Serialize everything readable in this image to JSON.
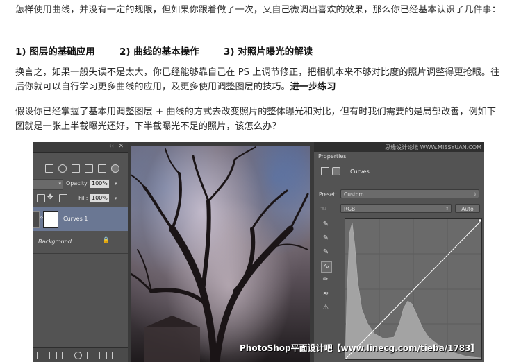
{
  "article": {
    "p1": "怎样使用曲线，并没有一定的规限，但如果你跟着做了一次，又自己微调出喜欢的效果，那么你已经基本认识了几件事：",
    "heading1": "1) 图层的基础应用",
    "heading2": "2) 曲线的基本操作",
    "heading3": "3) 对照片曝光的解读",
    "p2": "换言之，如果一般失误不是太大，你已经能够靠自己在 PS 上调节修正，把相机本来不够对比度的照片调整得更抢眼。往后你就可以自行学习更多曲线的应用，及更多使用调整图层的技巧。",
    "p2_bold": "进一步练习",
    "p3": "假设你已经掌握了基本用调整图层 + 曲线的方式去改变照片的整体曝光和对比，但有时我们需要的是局部改善，例如下图就是一张上半截曝光还好，下半截曝光不足的照片，该怎么办？"
  },
  "screenshot": {
    "layers_panel": {
      "opacity_label": "Opacity:",
      "opacity_value": "100%",
      "fill_label": "Fill:",
      "fill_value": "100%",
      "layer_curves": "Curves 1",
      "layer_background": "Background"
    },
    "properties_panel": {
      "tab": "Properties",
      "site_watermark": "思缘设计论坛 WWW.MISSYUAN.COM",
      "adjustment_name": "Curves",
      "preset_label": "Preset:",
      "preset_value": "Custom",
      "channel_value": "RGB",
      "auto_button": "Auto"
    },
    "photo_watermark": "PhotoShop平面设计吧【www.linecg.com/tieba/1783】"
  },
  "colors": {
    "ps_panel": "#535353",
    "ps_dark": "#3a3a3a",
    "layer_selected": "#6a7793",
    "histogram": "#9a9a9a"
  }
}
